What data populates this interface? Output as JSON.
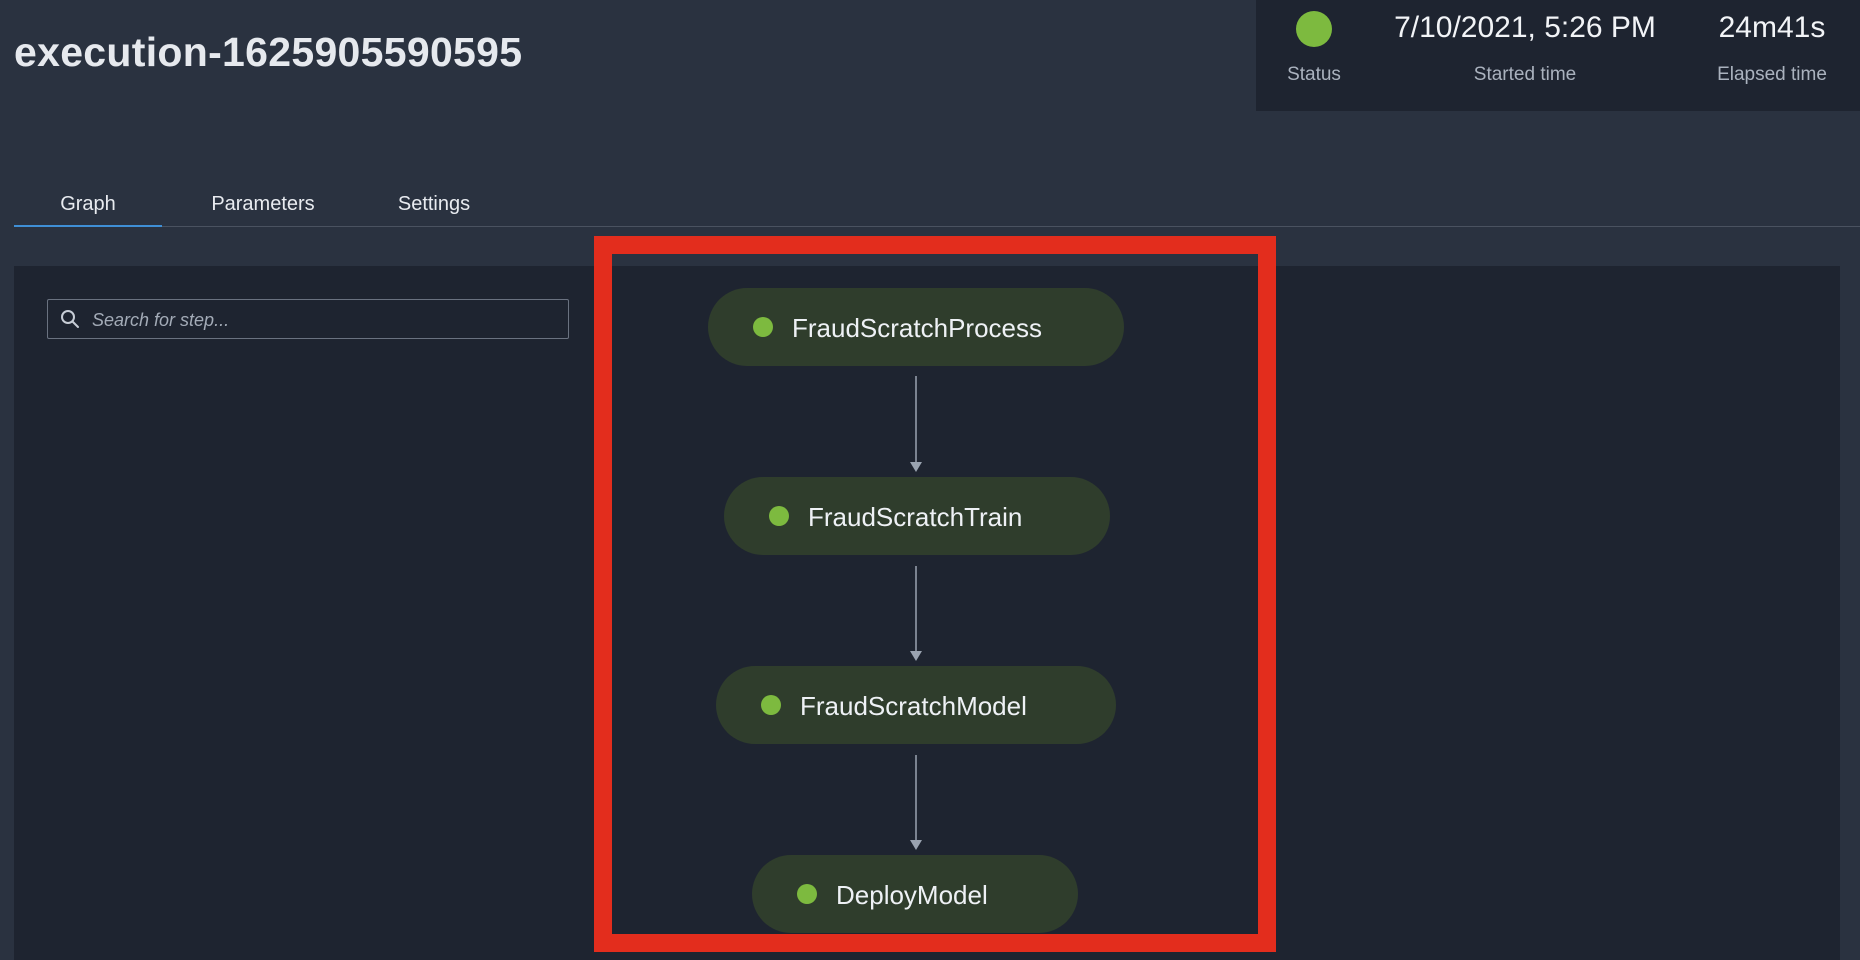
{
  "execution": {
    "title": "execution-1625905590595"
  },
  "summary": {
    "status_label": "Status",
    "status_color": "#7dba3f",
    "started_time": "7/10/2021, 5:26 PM",
    "started_label": "Started time",
    "elapsed_time": "24m41s",
    "elapsed_label": "Elapsed time"
  },
  "tabs": [
    {
      "label": "Graph",
      "active": true
    },
    {
      "label": "Parameters",
      "active": false
    },
    {
      "label": "Settings",
      "active": false
    }
  ],
  "search": {
    "placeholder": "Search for step...",
    "icon": "search-icon"
  },
  "graph": {
    "steps": [
      {
        "name": "FraudScratchProcess",
        "status_color": "#7dba3f"
      },
      {
        "name": "FraudScratchTrain",
        "status_color": "#7dba3f"
      },
      {
        "name": "FraudScratchModel",
        "status_color": "#7dba3f"
      },
      {
        "name": "DeployModel",
        "status_color": "#7dba3f"
      }
    ],
    "edge_color": "#9aa3b0",
    "highlight_color": "#e32d1d"
  }
}
